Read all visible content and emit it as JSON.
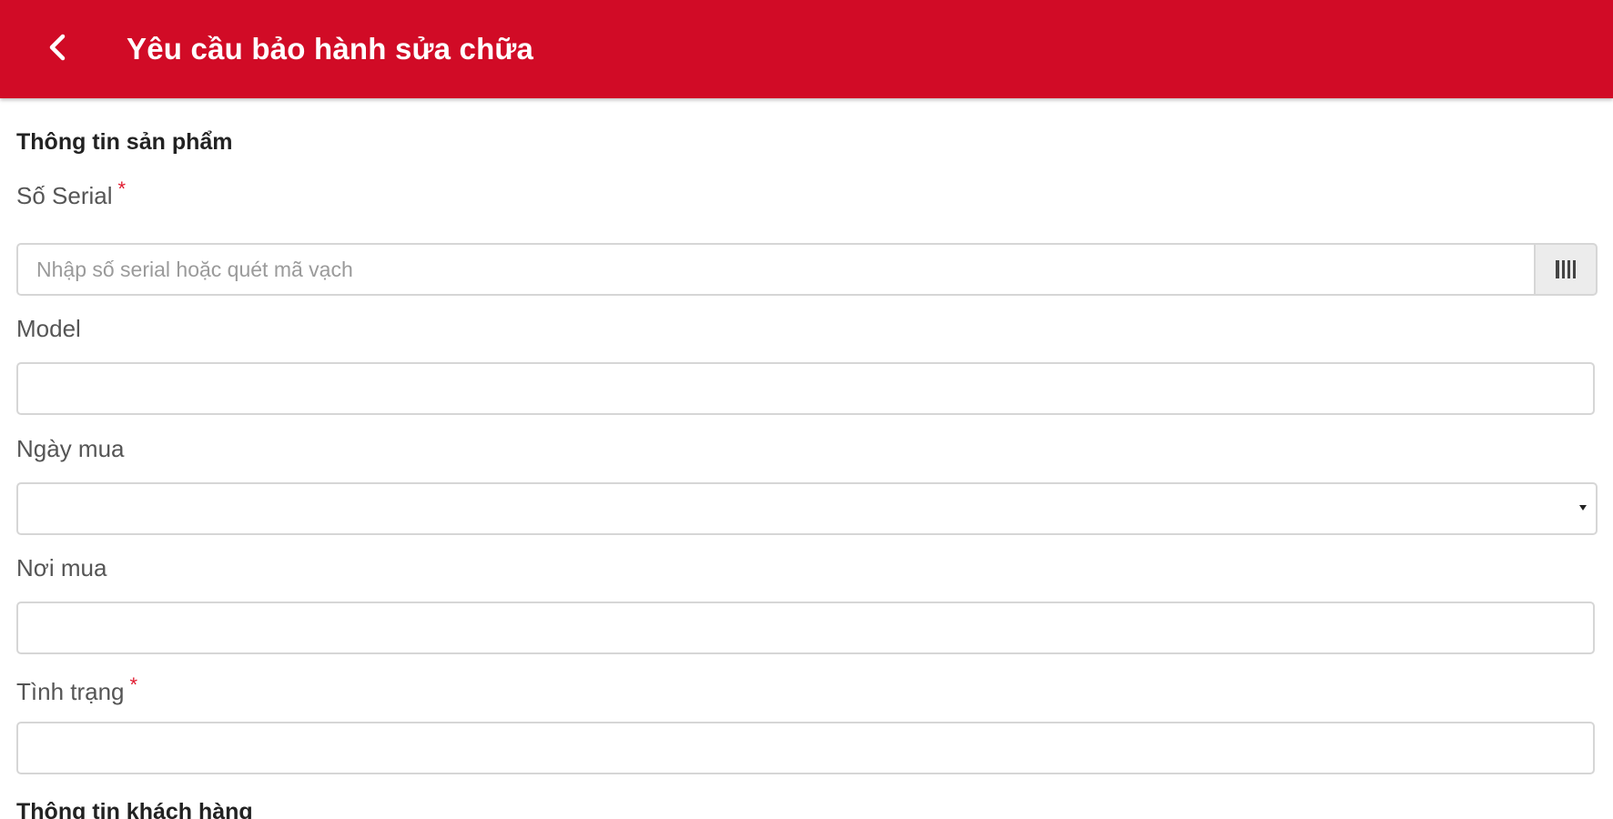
{
  "header": {
    "title": "Yêu cầu bảo hành sửa chữa",
    "back_icon": "chevron-left-icon"
  },
  "colors": {
    "app_bar": "#d10b26",
    "required": "#e0192e"
  },
  "product_section": {
    "title": "Thông tin sản phẩm",
    "serial": {
      "label": "Số Serial",
      "required_mark": "*",
      "value": "",
      "placeholder": "Nhập số serial hoặc quét mã vạch",
      "scan_icon": "barcode-icon"
    },
    "model": {
      "label": "Model",
      "value": ""
    },
    "purchase_date": {
      "label": "Ngày mua",
      "selected": ""
    },
    "purchase_place": {
      "label": "Nơi mua",
      "value": ""
    },
    "condition": {
      "label": "Tình trạng",
      "required_mark": "*",
      "value": ""
    }
  },
  "customer_section": {
    "title": "Thông tin khách hàng"
  }
}
